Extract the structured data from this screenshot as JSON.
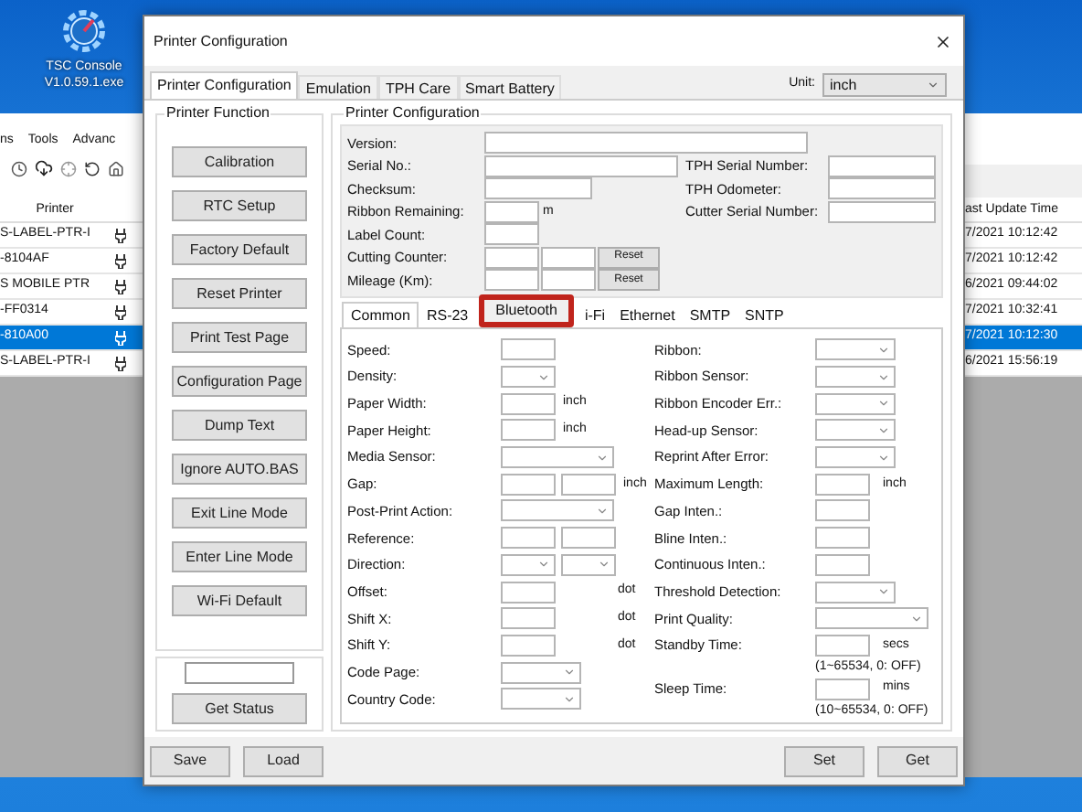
{
  "desktop_icon": {
    "lines": [
      "TSC Console",
      "V1.0.59.1.exe"
    ]
  },
  "background_app": {
    "menu": [
      "ns",
      "Tools",
      "Advanc"
    ],
    "left_header": "Printer",
    "right_header": "ast Update Time",
    "rows": [
      {
        "printer": "S-LABEL-PTR-I",
        "time": "7/2021 10:12:42",
        "selected": false
      },
      {
        "printer": "-8104AF",
        "time": "7/2021 10:12:42",
        "selected": false
      },
      {
        "printer": "S MOBILE PTR",
        "time": "6/2021 09:44:02",
        "selected": false
      },
      {
        "printer": "-FF0314",
        "time": "7/2021 10:32:41",
        "selected": false
      },
      {
        "printer": "-810A00",
        "time": "7/2021 10:12:30",
        "selected": true
      },
      {
        "printer": "S-LABEL-PTR-I",
        "time": "6/2021 15:56:19",
        "selected": false
      }
    ]
  },
  "dialog": {
    "title": "Printer Configuration",
    "tabs": [
      {
        "label": "Printer Configuration",
        "selected": true
      },
      {
        "label": "Emulation",
        "selected": false
      },
      {
        "label": "TPH Care",
        "selected": false
      },
      {
        "label": "Smart Battery",
        "selected": false
      }
    ],
    "unit": {
      "label": "Unit:",
      "value": "inch"
    },
    "function_group": {
      "title": "Printer Function",
      "buttons": [
        "Calibration",
        "RTC Setup",
        "Factory Default",
        "Reset Printer",
        "Print Test Page",
        "Configuration Page",
        "Dump Text",
        "Ignore AUTO.BAS",
        "Exit Line Mode",
        "Enter Line Mode",
        "Wi-Fi Default"
      ],
      "status_button": "Get Status"
    },
    "config_group": {
      "title": "Printer Configuration",
      "info_rows": [
        {
          "label": "Version:",
          "controls": [
            {
              "kind": "longfield"
            }
          ]
        },
        {
          "label": "Serial No.:",
          "controls": [
            {
              "kind": "widefield"
            }
          ],
          "right_label": "TPH Serial Number:"
        },
        {
          "label": "Checksum:",
          "controls": [
            {
              "kind": "midfield"
            }
          ],
          "right_label": "TPH Odometer:"
        },
        {
          "label": "Ribbon Remaining:",
          "controls": [
            {
              "kind": "field"
            },
            {
              "kind": "unit",
              "text": "m"
            }
          ],
          "right_label": "Cutter Serial Number:"
        },
        {
          "label": "Label Count:",
          "controls": [
            {
              "kind": "field"
            }
          ]
        },
        {
          "label": "Cutting Counter:",
          "controls": [
            {
              "kind": "field"
            },
            {
              "kind": "field"
            },
            {
              "kind": "button",
              "text": "Reset"
            }
          ]
        },
        {
          "label": "Mileage (Km):",
          "controls": [
            {
              "kind": "field"
            },
            {
              "kind": "field"
            },
            {
              "kind": "button",
              "text": "Reset"
            }
          ]
        }
      ],
      "tabs": [
        {
          "label": "Common",
          "selected": true,
          "highlighted": false
        },
        {
          "label": "RS-23",
          "selected": false,
          "highlighted": false
        },
        {
          "label": "Bluetooth",
          "selected": false,
          "highlighted": true
        },
        {
          "label": "i-Fi",
          "selected": false,
          "highlighted": false
        },
        {
          "label": "Ethernet",
          "selected": false,
          "highlighted": false
        },
        {
          "label": "SMTP",
          "selected": false,
          "highlighted": false
        },
        {
          "label": "SNTP",
          "selected": false,
          "highlighted": false
        }
      ],
      "left_rows": [
        {
          "label": "Speed:",
          "controls": [
            {
              "kind": "field"
            }
          ]
        },
        {
          "label": "Density:",
          "controls": [
            {
              "kind": "select"
            }
          ]
        },
        {
          "label": "Paper Width:",
          "controls": [
            {
              "kind": "field"
            },
            {
              "kind": "unit",
              "text": "inch"
            }
          ]
        },
        {
          "label": "Paper Height:",
          "controls": [
            {
              "kind": "field"
            },
            {
              "kind": "unit",
              "text": "inch"
            }
          ]
        },
        {
          "label": "Media Sensor:",
          "controls": [
            {
              "kind": "wideselect"
            }
          ]
        },
        {
          "label": "Gap:",
          "controls": [
            {
              "kind": "field"
            },
            {
              "kind": "field"
            },
            {
              "kind": "unit",
              "text": "inch"
            }
          ]
        },
        {
          "label": "Post-Print Action:",
          "controls": [
            {
              "kind": "wideselect"
            }
          ]
        },
        {
          "label": "Reference:",
          "controls": [
            {
              "kind": "field"
            },
            {
              "kind": "field"
            }
          ]
        },
        {
          "label": "Direction:",
          "controls": [
            {
              "kind": "select"
            },
            {
              "kind": "select"
            }
          ]
        },
        {
          "label": "Offset:",
          "controls": [
            {
              "kind": "field"
            },
            {
              "kind": "farunit",
              "text": "dot"
            }
          ]
        },
        {
          "label": "Shift X:",
          "controls": [
            {
              "kind": "field"
            },
            {
              "kind": "farunit",
              "text": "dot"
            }
          ]
        },
        {
          "label": "Shift Y:",
          "controls": [
            {
              "kind": "field"
            },
            {
              "kind": "farunit",
              "text": "dot"
            }
          ]
        },
        {
          "label": "Code Page:",
          "controls": [
            {
              "kind": "midselect"
            }
          ]
        },
        {
          "label": "Country Code:",
          "controls": [
            {
              "kind": "midselect"
            }
          ]
        }
      ],
      "right_rows": [
        {
          "label": "Ribbon:",
          "controls": [
            {
              "kind": "midselect"
            }
          ]
        },
        {
          "label": "Ribbon Sensor:",
          "controls": [
            {
              "kind": "midselect"
            }
          ]
        },
        {
          "label": "Ribbon Encoder Err.:",
          "controls": [
            {
              "kind": "midselect"
            }
          ]
        },
        {
          "label": "Head-up Sensor:",
          "controls": [
            {
              "kind": "midselect"
            }
          ]
        },
        {
          "label": "Reprint After Error:",
          "controls": [
            {
              "kind": "midselect"
            }
          ]
        },
        {
          "label": "Maximum Length:",
          "controls": [
            {
              "kind": "field"
            },
            {
              "kind": "unit",
              "text": "inch"
            }
          ]
        },
        {
          "label": "Gap Inten.:",
          "controls": [
            {
              "kind": "field"
            }
          ]
        },
        {
          "label": "Bline Inten.:",
          "controls": [
            {
              "kind": "field"
            }
          ]
        },
        {
          "label": "Continuous Inten.:",
          "controls": [
            {
              "kind": "field"
            }
          ]
        },
        {
          "label": "Threshold Detection:",
          "controls": [
            {
              "kind": "midselect"
            }
          ]
        },
        {
          "label": "Print Quality:",
          "controls": [
            {
              "kind": "wideselect"
            }
          ]
        },
        {
          "label": "Standby Time:",
          "controls": [
            {
              "kind": "field"
            },
            {
              "kind": "unit",
              "text": "secs"
            }
          ],
          "note": "(1~65534, 0: OFF)"
        },
        {
          "label": "Sleep Time:",
          "controls": [
            {
              "kind": "field"
            },
            {
              "kind": "unit",
              "text": "mins"
            }
          ],
          "note": "(10~65534, 0: OFF)"
        }
      ]
    },
    "footer": {
      "left": [
        "Save",
        "Load"
      ],
      "right": [
        "Set",
        "Get"
      ]
    }
  }
}
